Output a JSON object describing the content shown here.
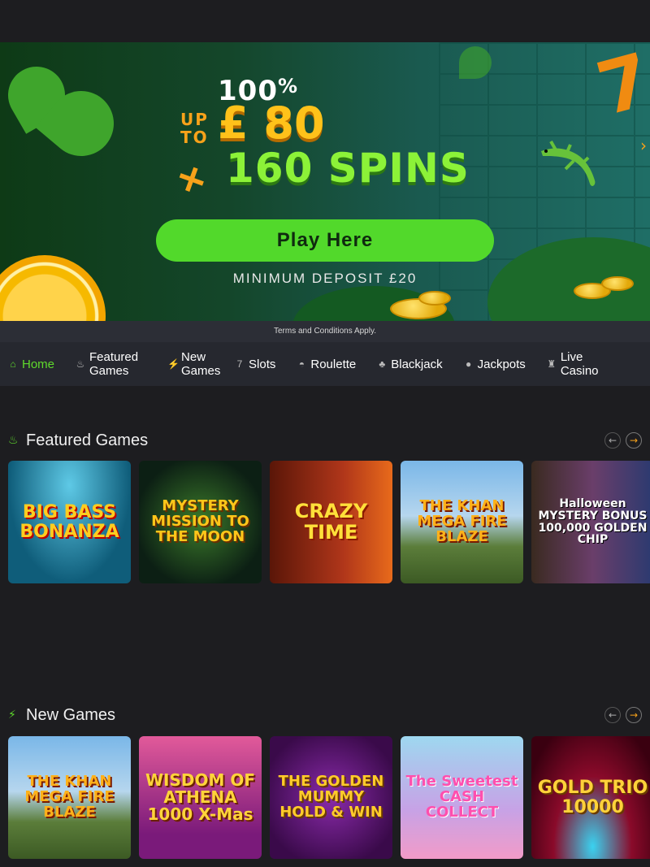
{
  "hero": {
    "percent": "100",
    "percent_sign": "%",
    "up_to": "UP TO",
    "amount": "£ 80",
    "plus": "+",
    "spins": "160 SPINS",
    "cta": "Play Here",
    "min_deposit": "MINIMUM DEPOSIT £20",
    "next_arrow": "›"
  },
  "terms": "Terms and Conditions Apply.",
  "nav": [
    {
      "label": "Home",
      "icon": "home-icon",
      "glyph": "⌂",
      "active": true
    },
    {
      "label": "Featured Games",
      "icon": "flame-icon",
      "glyph": "♨",
      "active": false
    },
    {
      "label": "New Games",
      "icon": "bolt-icon",
      "glyph": "⚡",
      "active": false
    },
    {
      "label": "Slots",
      "icon": "slot-machine-icon",
      "glyph": "7",
      "active": false
    },
    {
      "label": "Roulette",
      "icon": "roulette-icon",
      "glyph": "◓",
      "active": false
    },
    {
      "label": "Blackjack",
      "icon": "club-icon",
      "glyph": "♣",
      "active": false
    },
    {
      "label": "Jackpots",
      "icon": "money-bag-icon",
      "glyph": "●",
      "active": false
    },
    {
      "label": "Live Casino",
      "icon": "dealer-icon",
      "glyph": "♜",
      "active": false
    }
  ],
  "featured": {
    "title": "Featured Games",
    "prev": "←",
    "next": "→",
    "games": [
      {
        "name": "BIG BASS BONANZA"
      },
      {
        "name": "MYSTERY MISSION TO THE MOON"
      },
      {
        "name": "CRAZY TIME"
      },
      {
        "name": "THE KHAN MEGA FIRE BLAZE"
      },
      {
        "name": "Halloween MYSTERY BONUS 100,000 GOLDEN CHIP"
      }
    ]
  },
  "new_games": {
    "title": "New Games",
    "prev": "←",
    "next": "→",
    "games": [
      {
        "name": "THE KHAN MEGA FIRE BLAZE"
      },
      {
        "name": "WISDOM OF ATHENA 1000 X-Mas"
      },
      {
        "name": "THE GOLDEN MUMMY HOLD & WIN"
      },
      {
        "name": "The Sweetest CASH COLLECT"
      },
      {
        "name": "GOLD TRIO 10000"
      }
    ]
  },
  "colors": {
    "accent_green": "#52d92b",
    "accent_orange": "#f7a21a",
    "background": "#1d1d20"
  }
}
